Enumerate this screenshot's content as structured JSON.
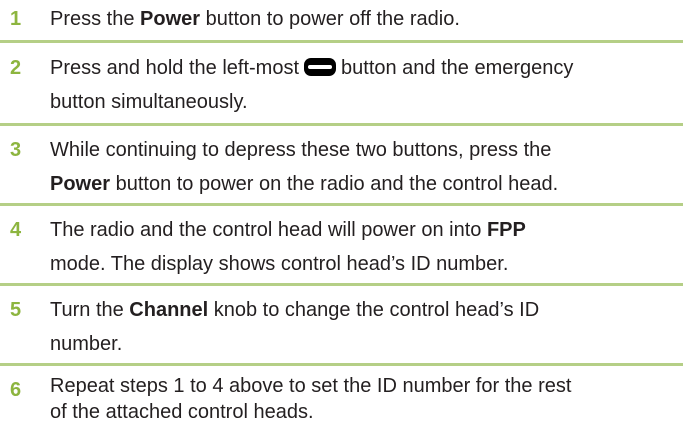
{
  "steps": [
    {
      "number": "1",
      "parts": [
        "Press the ",
        "Power",
        " button to power off the radio."
      ]
    },
    {
      "number": "2",
      "line1_before": "Press and hold the left-most",
      "icon": "oval-button-icon",
      "line1_after": "button and the emergency",
      "line2": "button simultaneously."
    },
    {
      "number": "3",
      "line1": "While continuing to depress these two buttons, press the",
      "line2_bold": "Power",
      "line2_rest": " button to power on the radio and the control head."
    },
    {
      "number": "4",
      "line1_before": "The radio and the control head will power on into ",
      "line1_bold": "FPP",
      "line2": "mode. The display shows control head’s ID number."
    },
    {
      "number": "5",
      "line1_before": "Turn the ",
      "line1_bold": "Channel",
      "line1_after": " knob to change the control head’s ID",
      "line2": "number."
    },
    {
      "number": "6",
      "line1": "Repeat steps 1 to 4 above to set the ID number for the rest",
      "line2": "of the attached control heads."
    }
  ],
  "colors": {
    "step_number": "#8db53f",
    "divider": "#b5cf86",
    "text": "#231f20"
  }
}
